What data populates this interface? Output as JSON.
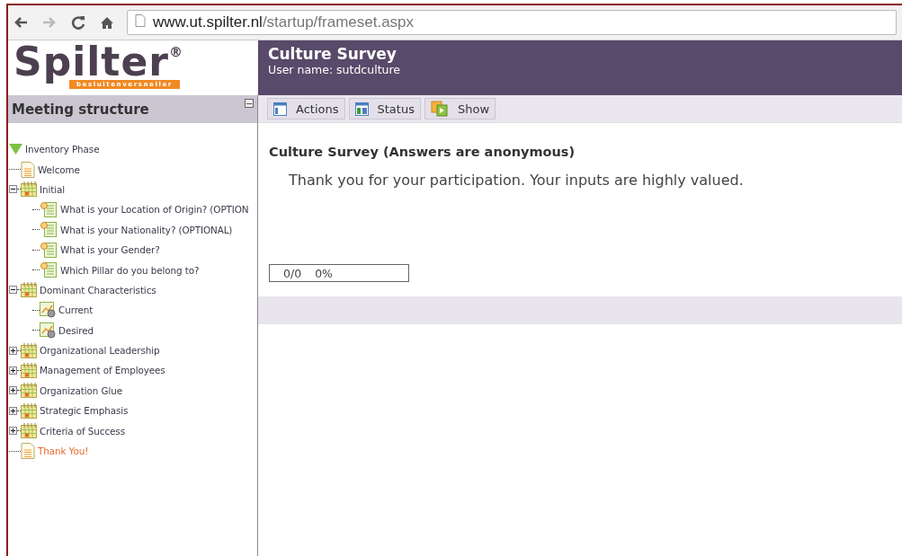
{
  "browser": {
    "url_host": "www.ut.spilter.nl",
    "url_path": "/startup/frameset.aspx"
  },
  "logo": {
    "text": "Spilter",
    "mark": "®",
    "tagline": "besluitenversneller"
  },
  "header": {
    "title": "Culture Survey",
    "user": "User name: sutdculture"
  },
  "sidebar": {
    "title": "Meeting structure",
    "collapse": "−",
    "tree": [
      {
        "kind": "phase",
        "label": "Inventory Phase",
        "expanded": true,
        "selected": false,
        "children": [
          {
            "kind": "page",
            "label": "Welcome",
            "selected": false
          },
          {
            "kind": "group",
            "label": "Initial",
            "expanded": true,
            "selected": false,
            "children": [
              {
                "kind": "question",
                "label": "What is your Location of Origin? (OPTION",
                "selected": false
              },
              {
                "kind": "question",
                "label": "What is your Nationality? (OPTIONAL)",
                "selected": false
              },
              {
                "kind": "question",
                "label": "What is your Gender?",
                "selected": false
              },
              {
                "kind": "question",
                "label": "Which Pillar do you belong to?",
                "selected": false
              }
            ]
          },
          {
            "kind": "group",
            "label": "Dominant Characteristics",
            "expanded": true,
            "selected": false,
            "children": [
              {
                "kind": "chart",
                "label": "Current",
                "selected": false
              },
              {
                "kind": "chart",
                "label": "Desired",
                "selected": false
              }
            ]
          },
          {
            "kind": "group",
            "label": "Organizational Leadership",
            "expanded": false,
            "selected": false
          },
          {
            "kind": "group",
            "label": "Management of Employees",
            "expanded": false,
            "selected": false
          },
          {
            "kind": "group",
            "label": "Organization Glue",
            "expanded": false,
            "selected": false
          },
          {
            "kind": "group",
            "label": "Strategic Emphasis",
            "expanded": false,
            "selected": false
          },
          {
            "kind": "group",
            "label": "Criteria of Success",
            "expanded": false,
            "selected": false
          },
          {
            "kind": "page",
            "label": "Thank You!",
            "selected": true
          }
        ]
      }
    ]
  },
  "toolbar": [
    {
      "kind": "actions",
      "label": "Actions"
    },
    {
      "kind": "status",
      "label": "Status"
    },
    {
      "kind": "show",
      "label": "Show"
    }
  ],
  "content": {
    "heading": "Culture Survey (Answers are anonymous)",
    "message": "Thank you for your participation. Your inputs are highly valued.",
    "progress": {
      "count": "0/0",
      "percent": "0%",
      "level": 0
    }
  }
}
